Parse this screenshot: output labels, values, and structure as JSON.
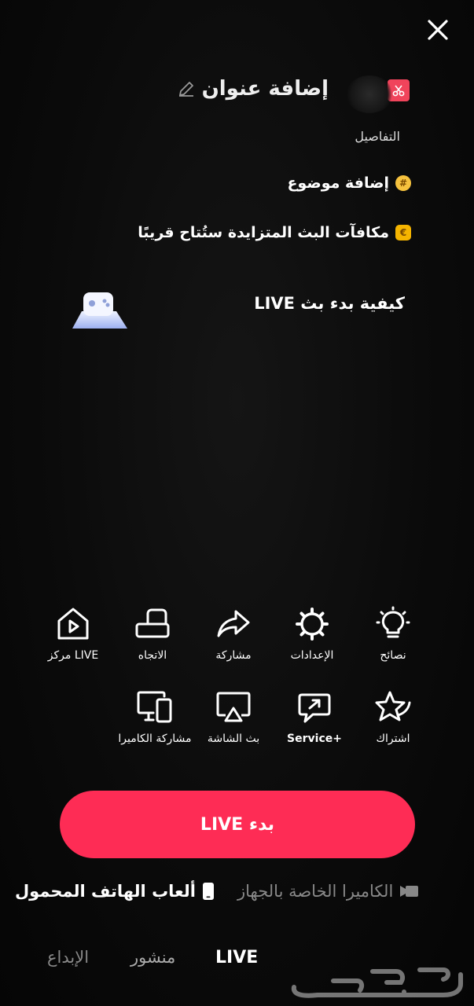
{
  "header": {
    "title": "إضافة عنوان",
    "details": "التفاصيل",
    "topic": "إضافة موضوع",
    "bonus": "مكافآت البث المتزايدة ستُتاح قريبًا",
    "howto": "كيفية بدء بث LIVE"
  },
  "tools_row1": [
    {
      "label": "نصائح",
      "icon": "lightbulb-icon"
    },
    {
      "label": "الإعدادات",
      "icon": "gear-icon"
    },
    {
      "label": "مشاركة",
      "icon": "share-icon"
    },
    {
      "label": "الاتجاه",
      "icon": "orientation-icon"
    },
    {
      "label": "مركز LIVE",
      "icon": "live-center-icon"
    }
  ],
  "tools_row2": [
    {
      "label": "اشتراك",
      "icon": "subscription-star-icon"
    },
    {
      "label": "Service+",
      "icon": "service-chat-icon"
    },
    {
      "label": "بث الشاشة",
      "icon": "screencast-icon"
    },
    {
      "label": "مشاركة الكاميرا",
      "icon": "camera-share-devices-icon"
    }
  ],
  "start_button": {
    "label": "بدء LIVE",
    "color": "#fe2c55"
  },
  "modes": {
    "mobile_games": "ألعاب الهاتف المحمول",
    "device_camera": "الكاميرا الخاصة بالجهاز"
  },
  "bottom_tabs": {
    "live": "LIVE",
    "post": "منشور",
    "create": "الإبداع"
  },
  "watermark_text": "حراج"
}
